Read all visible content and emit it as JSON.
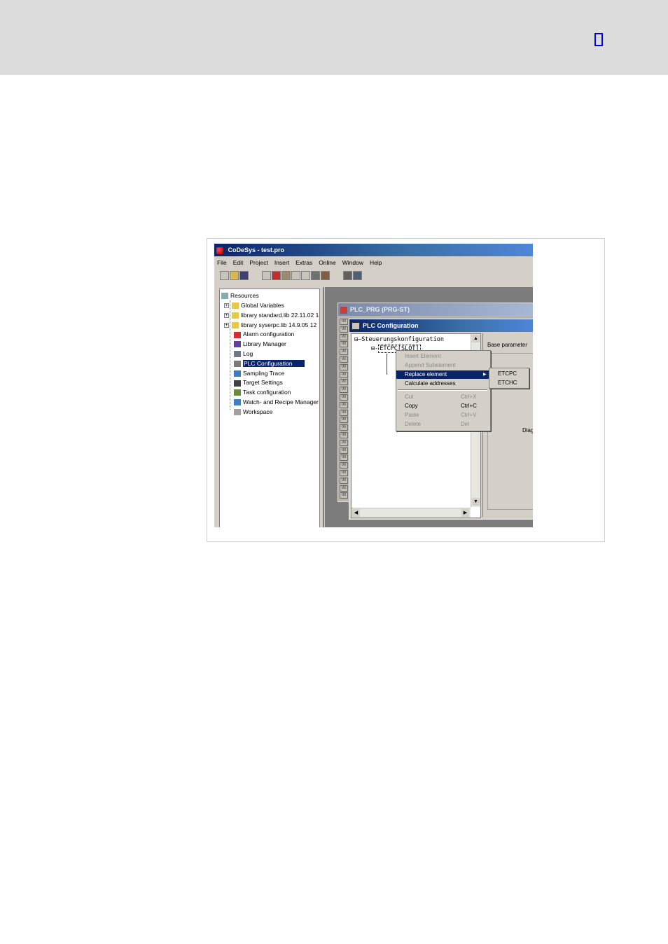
{
  "header": {
    "colors": {
      "band": "#dcdcdc",
      "box_border": "#0000e0"
    }
  },
  "app": {
    "title": "CoDeSys - test.pro",
    "menu": [
      "File",
      "Edit",
      "Project",
      "Insert",
      "Extras",
      "Online",
      "Window",
      "Help"
    ],
    "colors": {
      "titlebar": "#0a246a",
      "face": "#d4d0c8",
      "workspace": "#808080",
      "selection": "#0a246a"
    }
  },
  "resources": {
    "root": "Resources",
    "items": [
      {
        "label": "Global Variables",
        "icon": "folder-icon",
        "expand": "+"
      },
      {
        "label": "library standard.lib 22.11.02 1",
        "icon": "folder-icon",
        "expand": "+"
      },
      {
        "label": "library syserpc.lib 14.9.05 12",
        "icon": "folder-icon",
        "expand": "+"
      },
      {
        "label": "Alarm configuration",
        "icon": "alarm-icon",
        "expand": ""
      },
      {
        "label": "Library Manager",
        "icon": "library-icon",
        "expand": ""
      },
      {
        "label": "Log",
        "icon": "log-icon",
        "expand": ""
      },
      {
        "label": "PLC Configuration",
        "icon": "plc-config-icon",
        "expand": "",
        "selected": true
      },
      {
        "label": "Sampling Trace",
        "icon": "trace-icon",
        "expand": ""
      },
      {
        "label": "Target Settings",
        "icon": "target-icon",
        "expand": ""
      },
      {
        "label": "Task configuration",
        "icon": "task-icon",
        "expand": ""
      },
      {
        "label": "Watch- and Recipe Manager",
        "icon": "watch-icon",
        "expand": ""
      },
      {
        "label": "Workspace",
        "icon": "workspace-icon",
        "expand": ""
      }
    ]
  },
  "prg_window": {
    "title": "PLC_PRG (PRG-ST)",
    "cell_text": "00"
  },
  "plc_window": {
    "title": "PLC Configuration",
    "tree_root": "Steuerungskonfiguration",
    "tree_child": "ETCPC[SLOT]",
    "right_panel_label": "Base parameter",
    "right_panel_label2": "Diag"
  },
  "context_menu": {
    "items": [
      {
        "label": "Insert Element",
        "shortcut": "",
        "enabled": false
      },
      {
        "label": "Append Subelement",
        "shortcut": "",
        "enabled": false
      },
      {
        "label": "Replace element",
        "shortcut": "",
        "enabled": true,
        "highlighted": true,
        "submenu": true
      },
      {
        "label": "Calculate addresses",
        "shortcut": "",
        "enabled": true
      },
      {
        "label": "Cut",
        "shortcut": "Ctrl+X",
        "enabled": false
      },
      {
        "label": "Copy",
        "shortcut": "Ctrl+C",
        "enabled": true
      },
      {
        "label": "Paste",
        "shortcut": "Ctrl+V",
        "enabled": false
      },
      {
        "label": "Delete",
        "shortcut": "Del",
        "enabled": false
      }
    ],
    "submenu": [
      "ETCPC",
      "ETCHC"
    ]
  }
}
